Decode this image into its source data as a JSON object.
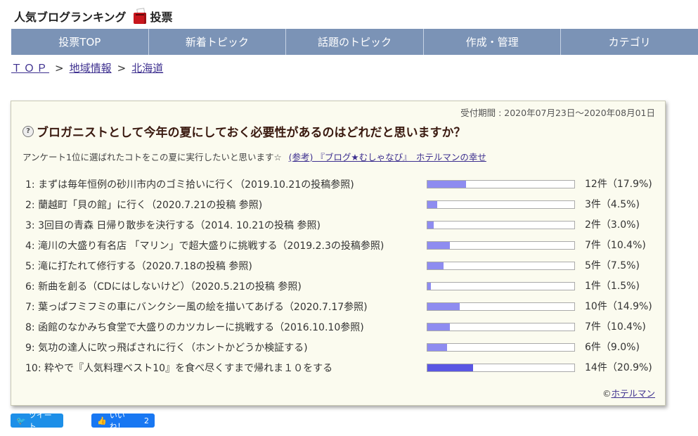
{
  "header": {
    "site_title": "人気ブログランキング",
    "vote_label": "投票"
  },
  "nav": [
    "投票TOP",
    "新着トピック",
    "話題のトピック",
    "作成・管理",
    "カテゴリ"
  ],
  "breadcrumb": {
    "top": "ＴＯＰ",
    "sep": ">",
    "region": "地域情報",
    "area": "北海道"
  },
  "poll": {
    "period": "受付期間 : 2020年07月23日〜2020年08月01日",
    "question": "ブロガニストとして今年の夏にしておく必要性があるのはどれだと思いますか？",
    "intro": "アンケート1位に選ばれたコトをこの夏に実行したいと思います☆",
    "ref_link": "(参考) 『ブログ★むしゃなび』　ホテルマンの幸せ",
    "options": [
      {
        "label": "1: まずは毎年恒例の砂川市内のゴミ拾いに行く（2019.10.21の投稿参照)",
        "count": "12件（17.9%)",
        "percent": 17.9
      },
      {
        "label": "2: 蘭越町「貝の館」に行く（2020.7.21の投稿 参照)",
        "count": "3件（4.5%)",
        "percent": 4.5
      },
      {
        "label": "3: 3回目の青森 日帰り散歩を決行する（2014. 10.21の投稿 参照)",
        "count": "2件（3.0%)",
        "percent": 3.0
      },
      {
        "label": "4: 滝川の大盛り有名店 「マリン」で超大盛りに挑戦する（2019.2.3の投稿参照)",
        "count": "7件（10.4%)",
        "percent": 10.4
      },
      {
        "label": "5: 滝に打たれて修行する（2020.7.18の投稿 参照)",
        "count": "5件（7.5%)",
        "percent": 7.5
      },
      {
        "label": "6: 新曲を創る（CDにはしないけど）（2020.5.21の投稿 参照)",
        "count": "1件（1.5%)",
        "percent": 1.5
      },
      {
        "label": "7: 葉っぱフミフミの車にバンクシー風の絵を描いてあげる（2020.7.17参照)",
        "count": "10件（14.9%)",
        "percent": 14.9
      },
      {
        "label": "8: 函館のなかみち食堂で大盛りのカツカレーに挑戦する（2016.10.10参照)",
        "count": "7件（10.4%)",
        "percent": 10.4
      },
      {
        "label": "9: 気功の達人に吹っ飛ばされに行く（ホントかどうか検証する)",
        "count": "6件（9.0%)",
        "percent": 9.0
      },
      {
        "label": "10: 粋やで『人気料理ベスト10』を食べ尽くすまで帰れま１０をする",
        "count": "14件（20.9%)",
        "percent": 20.9
      }
    ],
    "credit_prefix": "©",
    "credit_link": "ホテルマン"
  },
  "share": {
    "tweet_label": "ツイート",
    "like_label": "いいね！",
    "like_count": "2"
  },
  "colors": {
    "nav_bg": "#7b93b6",
    "bar_fill": "#8e8cf0",
    "bar_fill_top": "#5a57e3",
    "panel_bg": "#fbfbef",
    "link": "#3d2f8f",
    "twitter": "#1d8fe8",
    "facebook": "#1877f2"
  }
}
